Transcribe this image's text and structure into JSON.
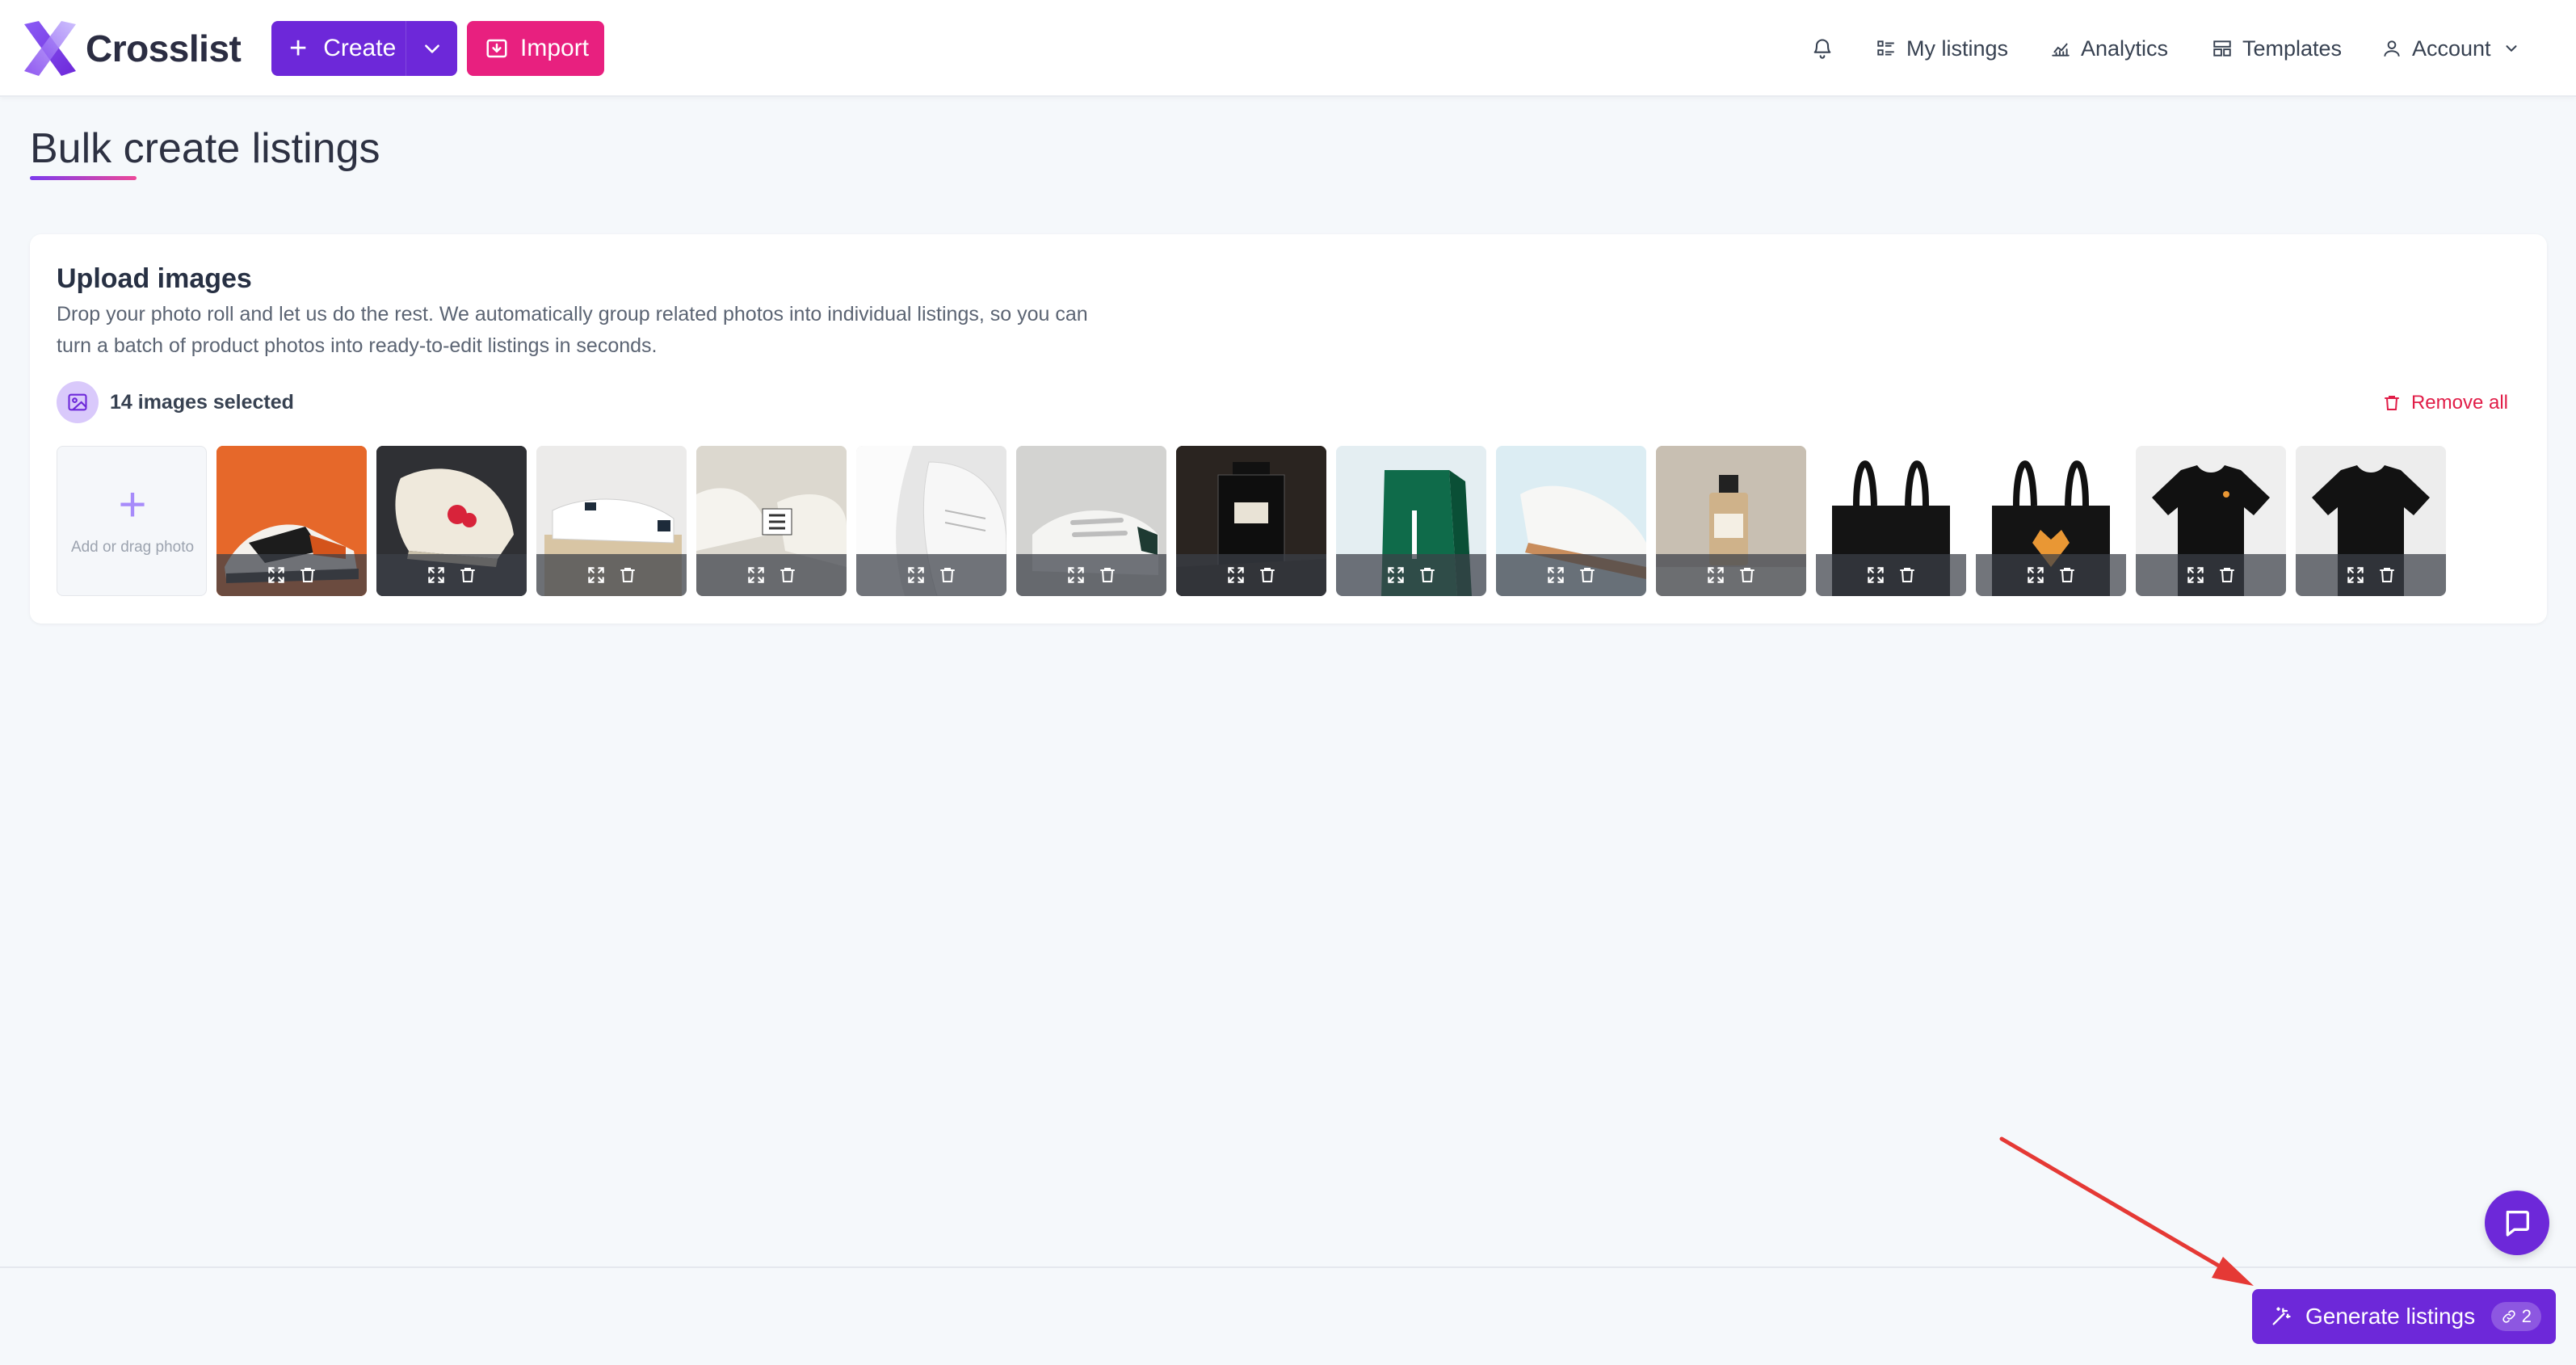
{
  "header": {
    "brand": "Crosslist",
    "create_label": "Create",
    "import_label": "Import",
    "nav": {
      "my_listings": "My listings",
      "analytics": "Analytics",
      "templates": "Templates",
      "account": "Account"
    },
    "icons": [
      "bell-icon",
      "list-icon",
      "chart-icon",
      "template-icon",
      "user-icon",
      "chevron-down-icon"
    ]
  },
  "page": {
    "title": "Bulk create listings"
  },
  "upload": {
    "title": "Upload images",
    "description": "Drop your photo roll and let us do the rest. We automatically group related photos into individual listings, so you can turn a batch of product photos into ready-to-edit listings in seconds.",
    "selected_count": "14 images selected",
    "remove_all": "Remove all",
    "add_tile": "Add or drag photo",
    "thumbnails": [
      "sneaker-orange",
      "sneaker-cdg",
      "sneaker-box",
      "sneaker-pair",
      "sneaker-closeup",
      "sneaker-velcro",
      "perfume-jo-malone",
      "lacoste-box",
      "sneaker-white",
      "perfume-bottle",
      "tote-black",
      "tote-fox",
      "tshirt-black-1",
      "tshirt-black-2"
    ]
  },
  "footer": {
    "generate_label": "Generate listings",
    "generate_count": "2"
  },
  "colors": {
    "primary": "#6d28d9",
    "accent": "#e8207f",
    "danger": "#e11d48"
  }
}
